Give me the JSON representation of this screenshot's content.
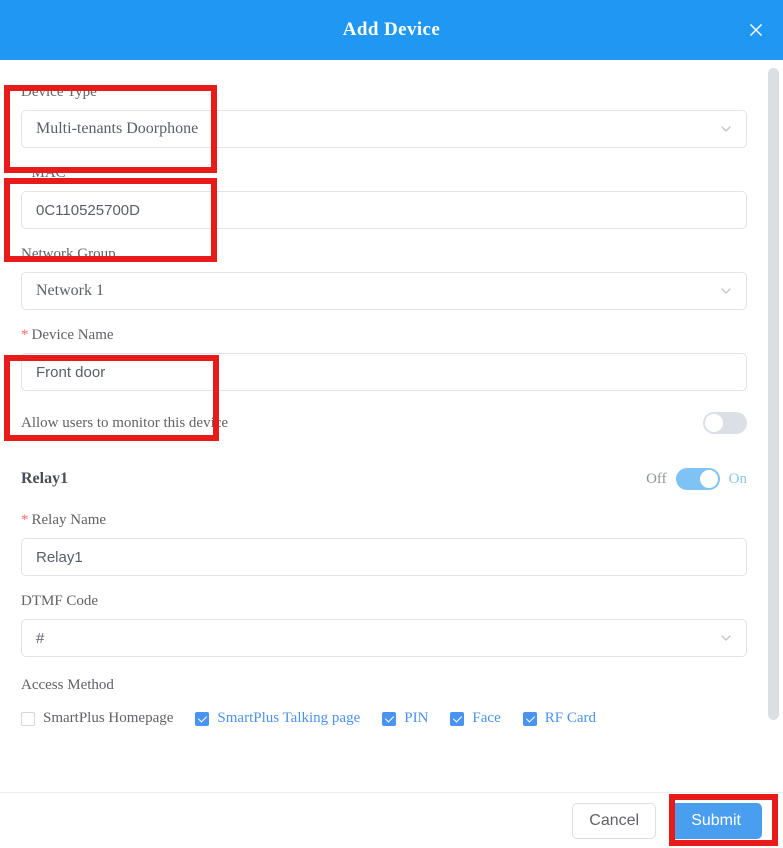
{
  "header": {
    "title": "Add Device",
    "close_icon": "close-icon",
    "background": "#2098f3"
  },
  "form": {
    "device_type": {
      "label": "Device Type",
      "required": false,
      "value": "Multi-tenants Doorphone",
      "type": "select",
      "chevron_icon": "chevron-down-icon"
    },
    "mac": {
      "label": "MAC",
      "required": true,
      "star": "*",
      "value": "0C110525700D",
      "type": "text"
    },
    "network_group": {
      "label": "Network Group",
      "required": false,
      "value": "Network 1",
      "type": "select",
      "chevron_icon": "chevron-down-icon"
    },
    "device_name": {
      "label": "Device Name",
      "required": true,
      "star": "*",
      "value": "Front door",
      "type": "text"
    },
    "monitor": {
      "label": "Allow users to monitor this device",
      "state": "off"
    },
    "relay": {
      "title": "Relay1",
      "off_label": "Off",
      "on_label": "On",
      "state": "on",
      "relay_name": {
        "label": "Relay Name",
        "required": true,
        "star": "*",
        "value": "Relay1",
        "type": "text"
      },
      "dtmf_code": {
        "label": "DTMF Code",
        "required": false,
        "value": "#",
        "type": "select",
        "chevron_icon": "chevron-down-icon"
      }
    },
    "access_method": {
      "label": "Access Method",
      "options": [
        {
          "label": "SmartPlus Homepage",
          "checked": false
        },
        {
          "label": "SmartPlus Talking page",
          "checked": true
        },
        {
          "label": "PIN",
          "checked": true
        },
        {
          "label": "Face",
          "checked": true
        },
        {
          "label": "RF Card",
          "checked": true
        }
      ]
    }
  },
  "footer": {
    "cancel_label": "Cancel",
    "submit_label": "Submit"
  },
  "colors": {
    "header_blue": "#2098f3",
    "primary_blue": "#4a9ef0",
    "checkbox_blue": "#4a93f0",
    "switch_on": "#7fc3f5",
    "switch_off": "#dcdfe6",
    "required_red": "#f56c6c",
    "annotation_red": "#e81b1b",
    "label_gray": "#606266"
  },
  "annotations": {
    "boxes": [
      {
        "name": "device-type-highlight"
      },
      {
        "name": "mac-highlight"
      },
      {
        "name": "device-name-highlight"
      },
      {
        "name": "submit-highlight"
      }
    ]
  }
}
